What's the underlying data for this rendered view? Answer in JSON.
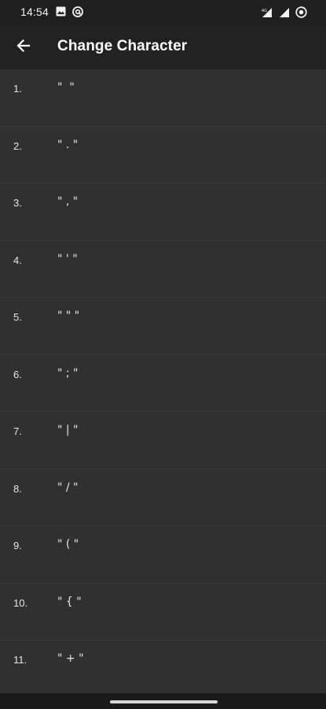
{
  "status_bar": {
    "time": "14:54",
    "icons_left": [
      "image-icon",
      "at-sign-icon"
    ],
    "icons_right": [
      "signal-4g-icon",
      "cell-signal-icon",
      "record-icon"
    ]
  },
  "app_bar": {
    "title": "Change Character",
    "back_icon": "arrow-left-icon"
  },
  "characters": [
    {
      "index": "1.",
      "value": "\"  \""
    },
    {
      "index": "2.",
      "value": "\" . \""
    },
    {
      "index": "3.",
      "value": "\" , \""
    },
    {
      "index": "4.",
      "value": "\" ' \""
    },
    {
      "index": "5.",
      "value": "\" \" \""
    },
    {
      "index": "6.",
      "value": "\" ; \""
    },
    {
      "index": "7.",
      "value": "\" | \""
    },
    {
      "index": "8.",
      "value": "\" / \""
    },
    {
      "index": "9.",
      "value": "\" ( \""
    },
    {
      "index": "10.",
      "value": "\" { \""
    },
    {
      "index": "11.",
      "value": "\" + \""
    }
  ]
}
